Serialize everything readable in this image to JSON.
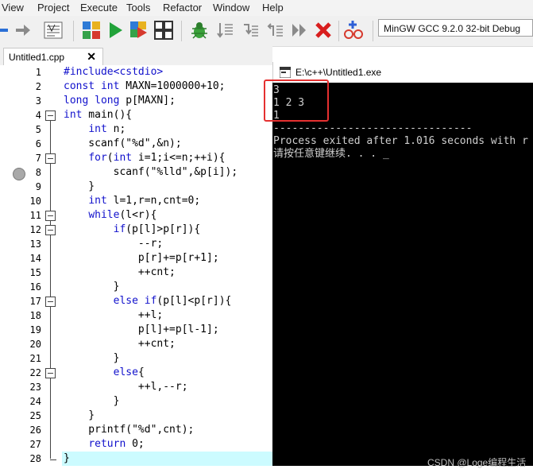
{
  "menubar": {
    "items": [
      "View",
      "Project",
      "Execute",
      "Tools",
      "Refactor",
      "Window",
      "Help"
    ]
  },
  "toolbar": {
    "compiler_select": "MinGW GCC 9.2.0 32-bit Debug"
  },
  "editor": {
    "tab_label": "Untitled1.cpp",
    "tab_close": "✕",
    "line_numbers": [
      "1",
      "2",
      "3",
      "4",
      "5",
      "6",
      "7",
      "8",
      "9",
      "10",
      "11",
      "12",
      "13",
      "14",
      "15",
      "16",
      "17",
      "18",
      "19",
      "20",
      "21",
      "22",
      "23",
      "24",
      "25",
      "26",
      "27",
      "28"
    ],
    "lines": [
      "#include<cstdio>",
      "const int MAXN=1000000+10;",
      "long long p[MAXN];",
      "int main(){",
      "    int n;",
      "    scanf(\"%d\",&n);",
      "    for(int i=1;i<=n;++i){",
      "        scanf(\"%lld\",&p[i]);",
      "    }",
      "    int l=1,r=n,cnt=0;",
      "    while(l<r){",
      "        if(p[l]>p[r]){",
      "            --r;",
      "            p[r]+=p[r+1];",
      "            ++cnt;",
      "        }",
      "        else if(p[l]<p[r]){",
      "            ++l;",
      "            p[l]+=p[l-1];",
      "            ++cnt;",
      "        }",
      "        else{",
      "            ++l,--r;",
      "        }",
      "    }",
      "    printf(\"%d\",cnt);",
      "    return 0;",
      "}"
    ]
  },
  "console": {
    "title": "E:\\c++\\Untitled1.exe",
    "lines": [
      "3",
      "1 2 3",
      "1",
      "--------------------------------",
      "Process exited after 1.016 seconds with r",
      "请按任意键继续. . . _"
    ]
  },
  "watermark": "CSDN @Loge编程生活"
}
